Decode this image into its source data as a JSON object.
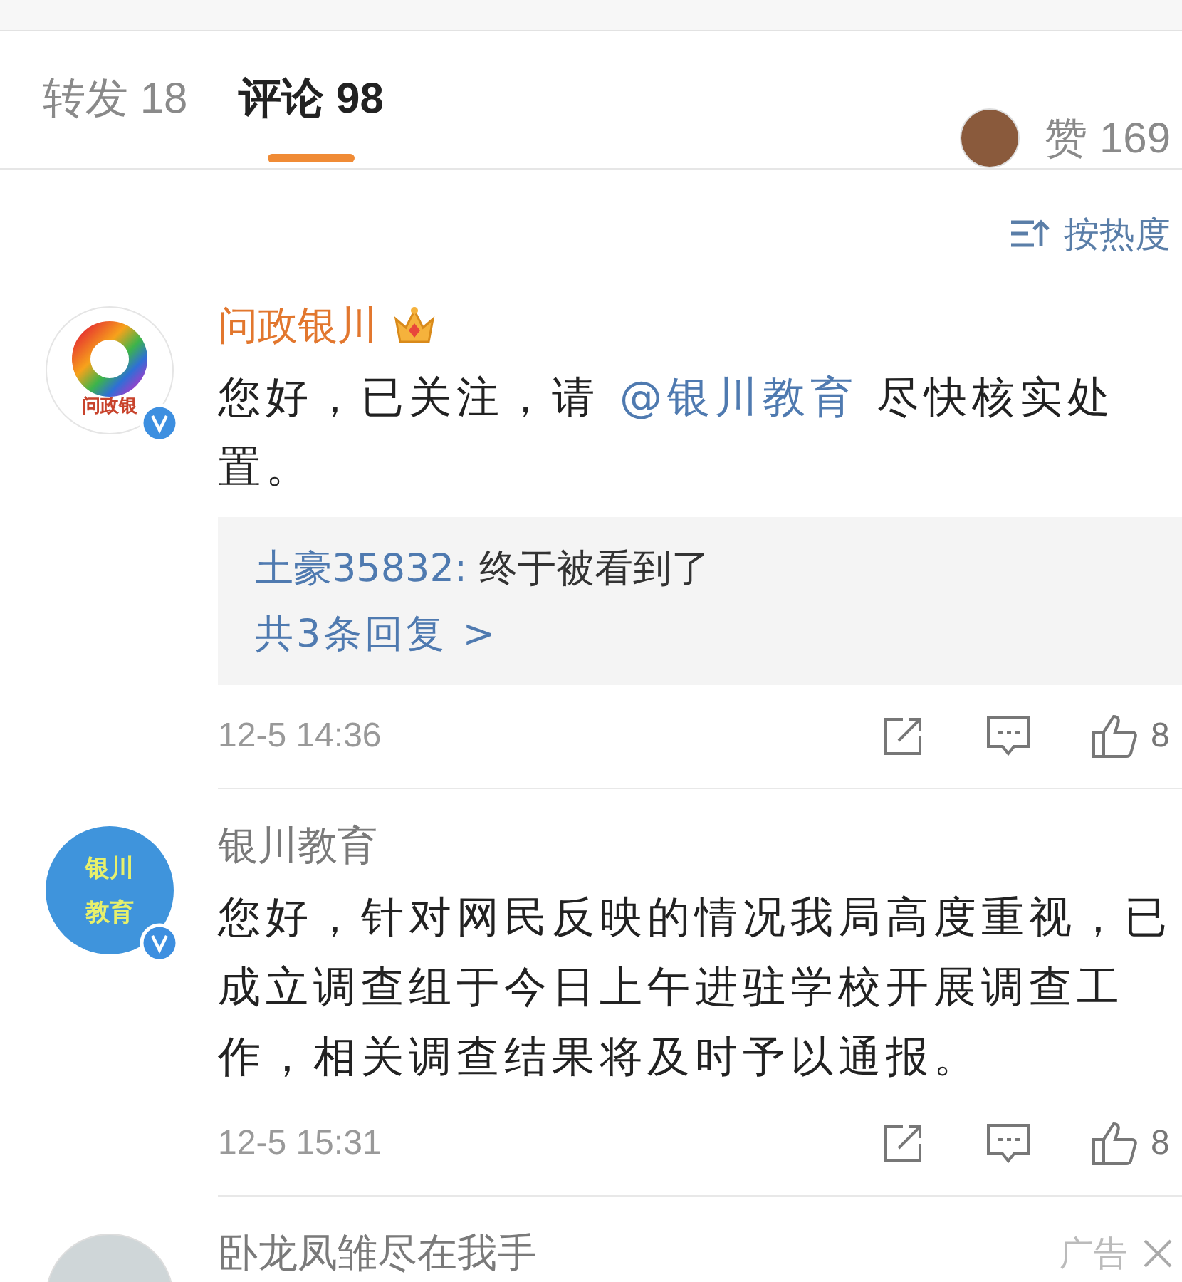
{
  "tabs": [
    {
      "label": "转发 18",
      "selected": false
    },
    {
      "label": "评论 98",
      "selected": true
    }
  ],
  "likes": {
    "label": "赞 169"
  },
  "sort": {
    "label": "按热度"
  },
  "comments": [
    {
      "kind": "full",
      "name": "问政银川",
      "vip": true,
      "verified": true,
      "avatar": {
        "kind": "rainbow",
        "text": [
          "问政银"
        ]
      },
      "body": [
        {
          "kind": "plain",
          "text": "您好，已关注，请"
        },
        {
          "kind": "mention",
          "text": "@银川教育"
        },
        {
          "kind": "plain",
          "text": " 尽快核实处置。"
        }
      ],
      "replies": {
        "preview": [
          {
            "user": "土豪35832:",
            "text": "终于被看到了"
          }
        ],
        "more": "共3条回复 >"
      },
      "time": "12-5 14:36",
      "like_count": "8"
    },
    {
      "kind": "full",
      "name": "银川教育",
      "vip": false,
      "verified": true,
      "avatar": {
        "kind": "blue",
        "text": [
          "银川",
          "教育"
        ]
      },
      "body": [
        {
          "kind": "plain",
          "text": "您好，针对网民反映的情况我局高度重视，已成立调查组于今日上午进驻学校开展调查工作，相关调查结果将及时予以通报。"
        }
      ],
      "time": "12-5 15:31",
      "like_count": "8"
    },
    {
      "kind": "ad",
      "name": "卧龙凤雏尽在我手",
      "vip": false,
      "avatar": {
        "kind": "photo"
      },
      "ad_label": "广告"
    }
  ]
}
